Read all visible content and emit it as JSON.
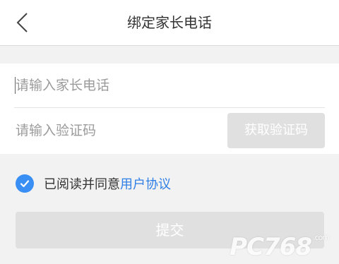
{
  "header": {
    "title": "绑定家长电话",
    "back_icon": "chevron-left-icon"
  },
  "form": {
    "phone_placeholder": "请输入家长电话",
    "phone_value": "",
    "code_placeholder": "请输入验证码",
    "code_value": "",
    "get_code_label": "获取验证码"
  },
  "agreement": {
    "checked": true,
    "text": "已阅读并同意",
    "link_text": "用户协议",
    "check_color": "#3a8ff5",
    "link_color": "#2f7fe6"
  },
  "submit": {
    "label": "提交"
  },
  "watermark": {
    "text": "PC768",
    "suffix": ".com"
  }
}
